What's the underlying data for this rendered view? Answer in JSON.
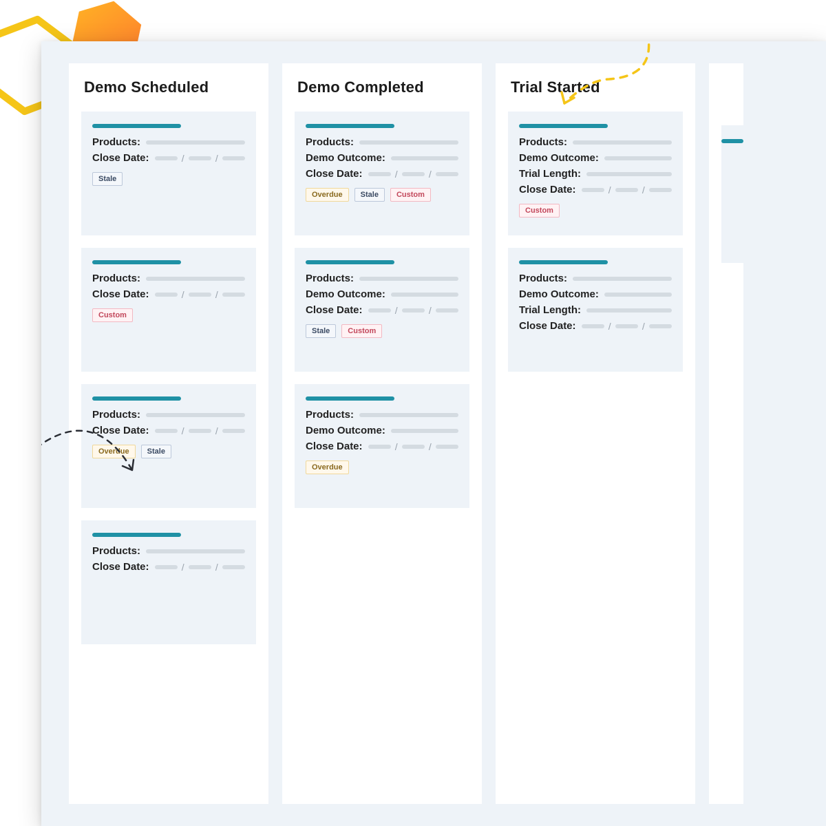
{
  "field_labels": {
    "products": "Products:",
    "close_date": "Close Date:",
    "demo_outcome": "Demo Outcome:",
    "trial_length": "Trial Length:"
  },
  "tag_labels": {
    "stale": "Stale",
    "overdue": "Overdue",
    "custom": "Custom"
  },
  "columns": [
    {
      "title": "Demo Scheduled",
      "cards": [
        {
          "fields": [
            "products",
            "close_date"
          ],
          "tags": [
            "stale"
          ]
        },
        {
          "fields": [
            "products",
            "close_date"
          ],
          "tags": [
            "custom"
          ]
        },
        {
          "fields": [
            "products",
            "close_date"
          ],
          "tags": [
            "overdue",
            "stale"
          ]
        },
        {
          "fields": [
            "products",
            "close_date"
          ],
          "tags": []
        }
      ]
    },
    {
      "title": "Demo Completed",
      "cards": [
        {
          "fields": [
            "products",
            "demo_outcome",
            "close_date"
          ],
          "tags": [
            "overdue",
            "stale",
            "custom"
          ]
        },
        {
          "fields": [
            "products",
            "demo_outcome",
            "close_date"
          ],
          "tags": [
            "stale",
            "custom"
          ]
        },
        {
          "fields": [
            "products",
            "demo_outcome",
            "close_date"
          ],
          "tags": [
            "overdue"
          ]
        }
      ]
    },
    {
      "title": "Trial Started",
      "cards": [
        {
          "fields": [
            "products",
            "demo_outcome",
            "trial_length",
            "close_date"
          ],
          "tags": [
            "custom"
          ]
        },
        {
          "fields": [
            "products",
            "demo_outcome",
            "trial_length",
            "close_date"
          ],
          "tags": []
        }
      ]
    }
  ]
}
